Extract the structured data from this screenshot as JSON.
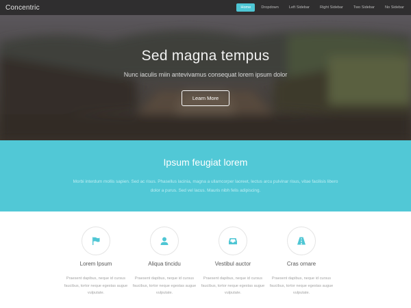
{
  "header": {
    "logo": "Concentric",
    "nav": [
      {
        "label": "Home",
        "active": true
      },
      {
        "label": "Dropdown",
        "active": false
      },
      {
        "label": "Left Sidebar",
        "active": false
      },
      {
        "label": "Right Sidebar",
        "active": false
      },
      {
        "label": "Two Sidebar",
        "active": false
      },
      {
        "label": "No Sidebar",
        "active": false
      }
    ]
  },
  "banner": {
    "title": "Sed magna tempus",
    "subtitle": "Nunc iaculis miin antevivamus consequat lorem ipsum dolor",
    "button": "Learn More"
  },
  "highlight": {
    "title": "Ipsum feugiat lorem",
    "text": "Morbi interdum mollis sapien. Sed ac risus. Phasellus lacinia, magna a ullamcorper laoreet, lectus arcu pulvinar risus, vitae facilisis libero dolor a purus. Sed vel lacus. Mauris nibh felis adipiscing."
  },
  "features": [
    {
      "icon": "flag-icon",
      "title": "Lorem Ipsum",
      "text": "Praesent dapibus, neque id cursus faucibus, tortor neque egestas augue vulputate."
    },
    {
      "icon": "user-icon",
      "title": "Aliqua tincidu",
      "text": "Praesent dapibus, neque id cursus faucibus, tortor neque egestas augue vulputate."
    },
    {
      "icon": "inbox-icon",
      "title": "Vestibul auctor",
      "text": "Praesent dapibus, neque id cursus faucibus, tortor neque egestas augue vulputate."
    },
    {
      "icon": "road-icon",
      "title": "Cras ornare",
      "text": "Praesent dapibus, neque id cursus faucibus, tortor neque egestas augue vulputate."
    }
  ],
  "colors": {
    "accent": "#4ec6d4",
    "header_bg": "#2f2e2f",
    "band_bg": "#51c8d6"
  }
}
